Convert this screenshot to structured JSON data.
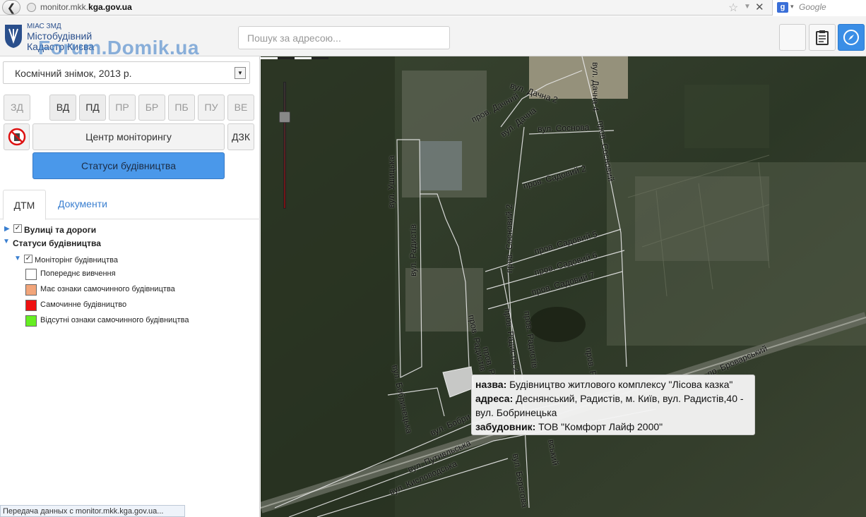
{
  "browser": {
    "url_prefix": "monitor.mkk.",
    "url_domain": "kga.gov.ua",
    "search_engine_label": "Google"
  },
  "header": {
    "logo_small": "МІАС ЗМД",
    "logo_line1": "Містобудівний",
    "logo_line2": "Кадастр Києва",
    "watermark": "Forum.Domik.ua",
    "search_placeholder": "Пошук за адресою...",
    "buttons": [
      "blank",
      "clipboard-icon",
      "compass-icon"
    ]
  },
  "sidebar": {
    "layer_select_value": "Космічний знімок, 2013 р.",
    "filter_buttons": [
      {
        "label": "ЗД МД",
        "active": false
      },
      {
        "label": "ВД",
        "active": true
      },
      {
        "label": "ПД",
        "active": true
      },
      {
        "label": "ПР",
        "active": false
      },
      {
        "label": "БР",
        "active": false
      },
      {
        "label": "ПБ",
        "active": false
      },
      {
        "label": "ПУ",
        "active": false
      },
      {
        "label": "ВЕ",
        "active": false
      }
    ],
    "monitor_center_label": "Центр моніторингу",
    "dzk_label": "ДЗК",
    "statuses_label": "Статуси будівництва",
    "tabs": [
      {
        "label": "ДТМ",
        "active": true
      },
      {
        "label": "Документи",
        "active": false
      }
    ],
    "tree": {
      "roads_label": "Вулиці та дороги",
      "statuses_label": "Статуси будівництва",
      "monitoring_label": "Моніторінг будівництва",
      "legend": [
        {
          "label": "Попереднє вивчення",
          "color": "#ffffff"
        },
        {
          "label": "Має ознаки самочинного будівництва",
          "color": "#f2a57a"
        },
        {
          "label": "Самочинне будівництво",
          "color": "#ee1111"
        },
        {
          "label": "Відсутні ознаки самочинного будівництва",
          "color": "#66ee22"
        }
      ]
    }
  },
  "map": {
    "street_labels": [
      {
        "text": "пров. Дачний",
        "rot": -28
      },
      {
        "text": "вул. Дачна 2",
        "rot": 18
      },
      {
        "text": "вул. Дачна",
        "rot": -38
      },
      {
        "text": "вул. Дачна 4",
        "rot": 90
      },
      {
        "text": "вул. Соснова",
        "rot": -2
      },
      {
        "text": "пров. Сосновий",
        "rot": 80
      },
      {
        "text": "пров. Садовий 2",
        "rot": -16
      },
      {
        "text": "вул. Ушицька",
        "rot": -90
      },
      {
        "text": "вул. Радистів",
        "rot": -90
      },
      {
        "text": "пров. Сосновий 2",
        "rot": -90
      },
      {
        "text": "пров. Садовий 5",
        "rot": -16
      },
      {
        "text": "пров. Садовий 6",
        "rot": -16
      },
      {
        "text": "пров. Садовий 7",
        "rot": -16
      },
      {
        "text": "пров. Радистів 2",
        "rot": 82
      },
      {
        "text": "пров. Радистів",
        "rot": 78
      },
      {
        "text": "пров. Радистів",
        "rot": 82
      },
      {
        "text": "пров. Радистів",
        "rot": 76
      },
      {
        "text": "пров. Р",
        "rot": 80
      },
      {
        "text": "вул. Бобринецька",
        "rot": 78
      },
      {
        "text": "вул. Бобри",
        "rot": -24
      },
      {
        "text": "вул. Путивльська",
        "rot": -24
      },
      {
        "text": "вул. Кисловодська",
        "rot": -24
      },
      {
        "text": "вул. Берегова",
        "rot": 80
      },
      {
        "text": "вський",
        "rot": 80
      },
      {
        "text": "пр. Броварський",
        "rot": -24
      }
    ],
    "popup": {
      "name_label": "назва:",
      "name_value": "Будівництво житлового комплексу \"Лісова казка\"",
      "address_label": "адреса:",
      "address_value": "Деснянський, Радистів, м. Київ, вул. Радистів,40 - вул. Бобринецька",
      "developer_label": "забудовник:",
      "developer_value": "ТОВ \"Комфорт Лайф 2000\""
    }
  },
  "statusbar_text": "Передача данных с monitor.mkk.kga.gov.ua..."
}
